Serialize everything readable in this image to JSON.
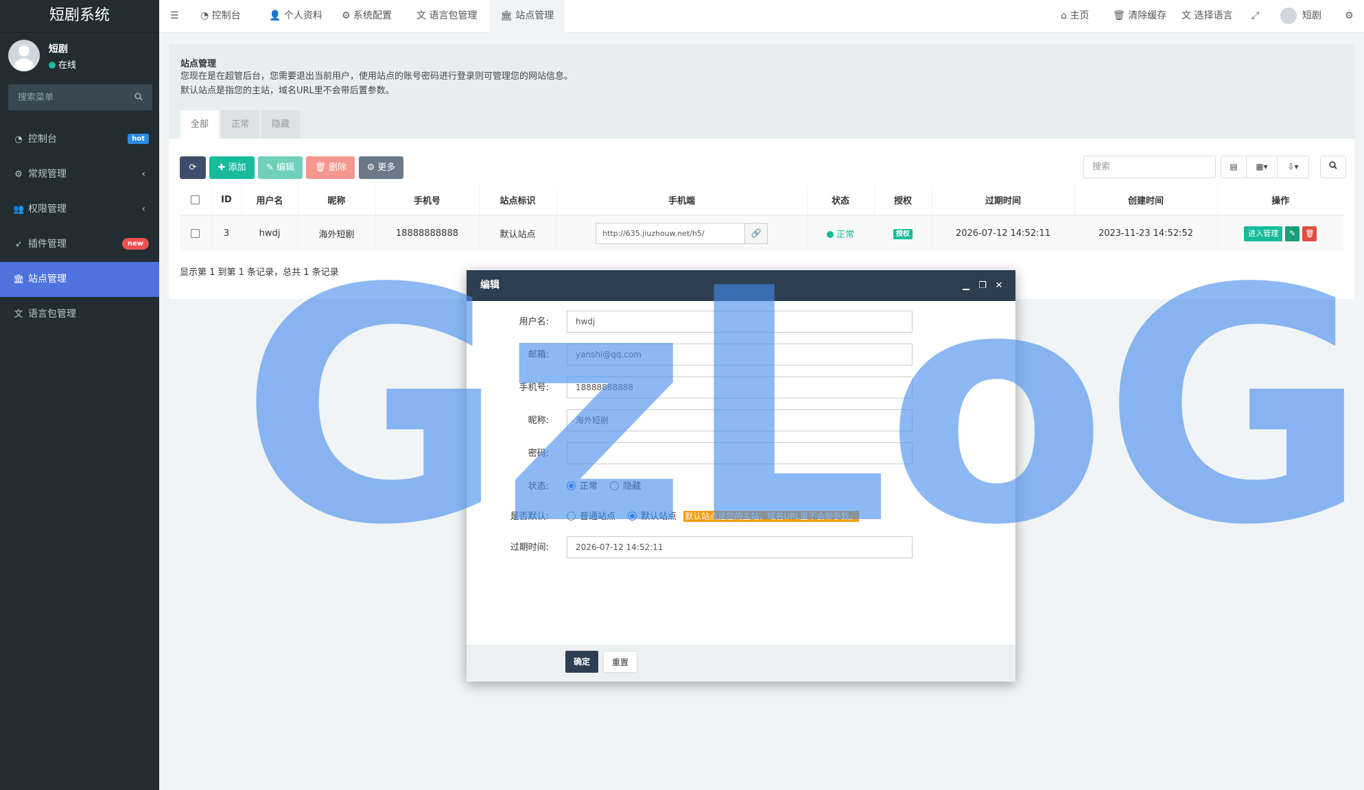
{
  "app": {
    "title": "短剧系统"
  },
  "user": {
    "name": "短剧",
    "status": "在线"
  },
  "sidebar": {
    "search_placeholder": "搜索菜单",
    "items": [
      {
        "label": "控制台",
        "icon": "dashboard-icon",
        "badge": "hot"
      },
      {
        "label": "常规管理",
        "icon": "cogs-icon"
      },
      {
        "label": "权限管理",
        "icon": "users-icon"
      },
      {
        "label": "插件管理",
        "icon": "rocket-icon",
        "badge": "new"
      },
      {
        "label": "站点管理",
        "icon": "bank-icon",
        "active": true
      },
      {
        "label": "语言包管理",
        "icon": "language-icon"
      }
    ]
  },
  "header": {
    "tabs": [
      "控制台",
      "个人资料",
      "系统配置",
      "语言包管理",
      "站点管理"
    ],
    "right": {
      "home": "主页",
      "clear_cache": "清除缓存",
      "language": "选择语言",
      "user": "短剧"
    }
  },
  "page": {
    "title": "站点管理",
    "desc1": "您现在是在超管后台，您需要退出当前用户，使用站点的账号密码进行登录则可管理您的网站信息。",
    "desc2": "默认站点是指您的主站，域名URL里不会带后置参数。",
    "tabs": [
      "全部",
      "正常",
      "隐藏"
    ]
  },
  "toolbar": {
    "add": "添加",
    "edit": "编辑",
    "delete": "删除",
    "more": "更多",
    "search_placeholder": "搜索"
  },
  "table": {
    "headers": [
      "ID",
      "用户名",
      "昵称",
      "手机号",
      "站点标识",
      "手机端",
      "状态",
      "授权",
      "过期时间",
      "创建时间",
      "操作"
    ],
    "rows": [
      {
        "id": "3",
        "username": "hwdj",
        "nickname": "海外短剧",
        "phone": "18888888888",
        "site_tag": "默认站点",
        "mobile_url": "http://635.jiuzhouw.net/h5/",
        "status": "正常",
        "auth": "授权",
        "expire": "2026-07-12 14:52:11",
        "created": "2023-11-23 14:52:52",
        "enter": "进入管理"
      }
    ],
    "summary": "显示第 1 到第 1 条记录，总共 1 条记录"
  },
  "modal": {
    "title": "编辑",
    "fields": {
      "username_label": "用户名:",
      "username": "hwdj",
      "email_label": "邮箱:",
      "email": "yanshi@qq.com",
      "phone_label": "手机号:",
      "phone": "18888888888",
      "nickname_label": "昵称:",
      "nickname": "海外短剧",
      "password_label": "密码:",
      "password": "",
      "status_label": "状态:",
      "status_normal": "正常",
      "status_hidden": "隐藏",
      "default_label": "是否默认:",
      "default_normal": "普通站点",
      "default_default": "默认站点",
      "default_hint": "默认站点是您的主站，域名URL里不会带参数。",
      "expire_label": "过期时间:",
      "expire": "2026-07-12 14:52:11"
    },
    "ok": "确定",
    "reset": "重置"
  },
  "watermark": "GzLoG",
  "colors": {
    "sidebar": "#222d32",
    "active": "#4e73df",
    "green": "#18bc9c",
    "modal_head": "#2c3e50",
    "hint": "#f39c12"
  }
}
